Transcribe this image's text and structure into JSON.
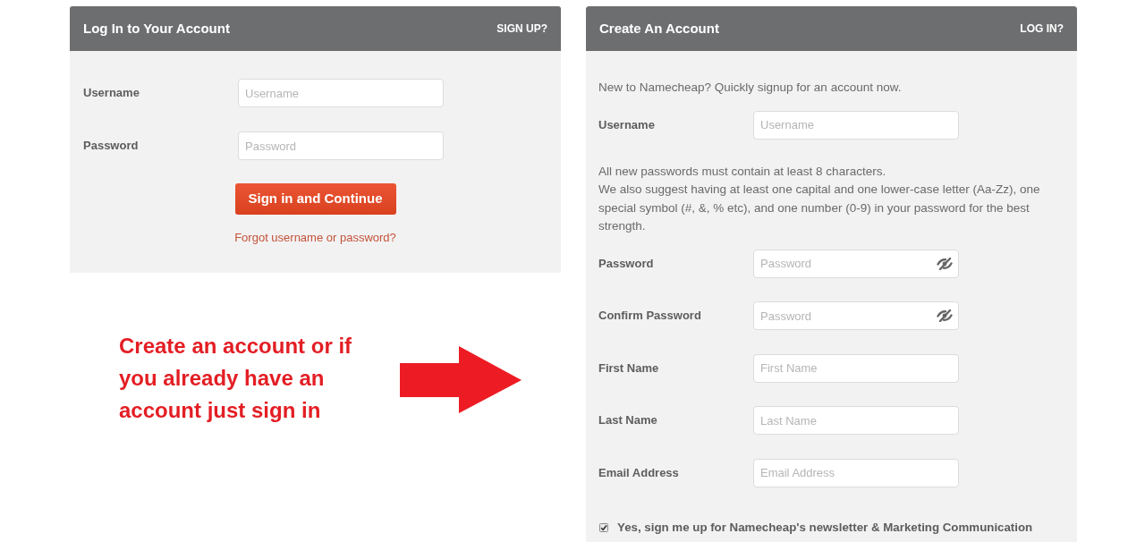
{
  "login_panel": {
    "title": "Log In to Your Account",
    "header_link": "SIGN UP?",
    "fields": [
      {
        "label": "Username",
        "placeholder": "Username"
      },
      {
        "label": "Password",
        "placeholder": "Password"
      }
    ],
    "submit_button": "Sign in and Continue",
    "forgot_link": "Forgot username or password?"
  },
  "callout": {
    "text": "Create an account or if you already have an account just sign in"
  },
  "signup_panel": {
    "title": "Create An Account",
    "header_link": "LOG IN?",
    "items": [
      {
        "kind": "note",
        "paragraphs": [
          "New to Namecheap? Quickly signup for an account now."
        ]
      },
      {
        "kind": "field",
        "label": "Username",
        "placeholder": "Username",
        "reveal_toggle": false
      },
      {
        "kind": "note",
        "paragraphs": [
          "All new passwords must contain at least 8 characters.",
          "We also suggest having at least one capital and one lower-case letter (Aa-Zz), one special symbol (#, &, % etc), and one number (0-9) in your password for the best strength."
        ]
      },
      {
        "kind": "field",
        "label": "Password",
        "placeholder": "Password",
        "reveal_toggle": true
      },
      {
        "kind": "field",
        "label": "Confirm Password",
        "placeholder": "Password",
        "reveal_toggle": true
      },
      {
        "kind": "field",
        "label": "First Name",
        "placeholder": "First Name",
        "reveal_toggle": false
      },
      {
        "kind": "field",
        "label": "Last Name",
        "placeholder": "Last Name",
        "reveal_toggle": false
      },
      {
        "kind": "field",
        "label": "Email Address",
        "placeholder": "Email Address",
        "reveal_toggle": false
      }
    ],
    "newsletter": {
      "label": "Yes, sign me up for Namecheap's newsletter & Marketing Communication",
      "checked": true
    }
  }
}
